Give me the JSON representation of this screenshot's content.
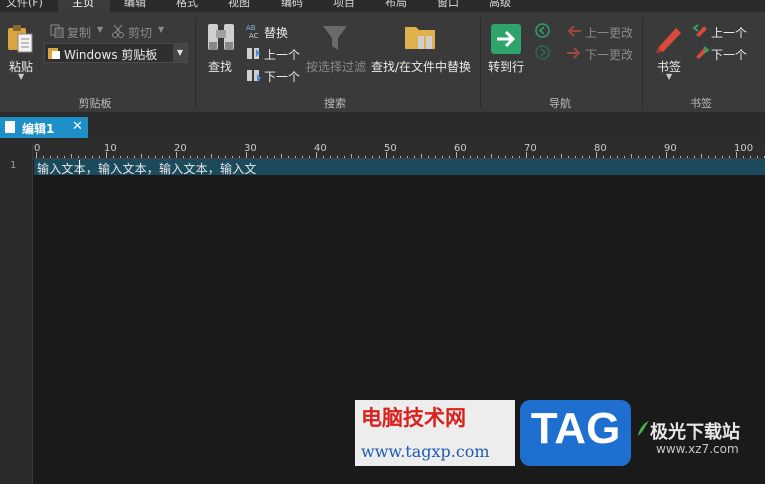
{
  "menubar": {
    "tabs": [
      "文件(F)",
      "主页",
      "编辑",
      "格式",
      "视图",
      "编码",
      "项目",
      "布局",
      "窗口",
      "高级"
    ],
    "active": "主页"
  },
  "ribbon": {
    "clipboard": {
      "paste": "粘贴",
      "copy": "复制",
      "cut": "剪切",
      "clipboard_select": "Windows 剪贴板",
      "group": "剪贴板"
    },
    "search": {
      "find": "查找",
      "replace": "替换",
      "prev": "上一个",
      "next": "下一个",
      "filter": "按选择过滤",
      "find_in_files": "查找/在文件中替换",
      "group": "搜索"
    },
    "navigation": {
      "goto_line": "转到行",
      "prev_change": "上一更改",
      "next_change": "下一更改",
      "group": "导航"
    },
    "bookmarks": {
      "bookmark": "书签",
      "prev": "上一个",
      "next": "下一个",
      "group": "书签"
    }
  },
  "document": {
    "tab_label": "编辑1",
    "line_number": "1",
    "line_text": "输入文本，输入文本，输入文本，输入文"
  },
  "ruler": {
    "labels": [
      "0",
      "10",
      "20",
      "30",
      "40",
      "50",
      "60",
      "70",
      "80",
      "90",
      "100"
    ]
  },
  "watermarks": {
    "site_cn": "电脑技术网",
    "site_url": "www.tagxp.com",
    "tag_logo": "TAG",
    "jg_title": "极光下载站",
    "jg_url": "www.xz7.com"
  },
  "colors": {
    "accent_tab": "#1e90c8",
    "current_line": "#1b4a5c",
    "ribbon_bg": "#3a3a3a",
    "editor_bg": "#1a1a1a",
    "goto_green": "#2ea36a",
    "bookmark_red": "#d84a3a"
  }
}
